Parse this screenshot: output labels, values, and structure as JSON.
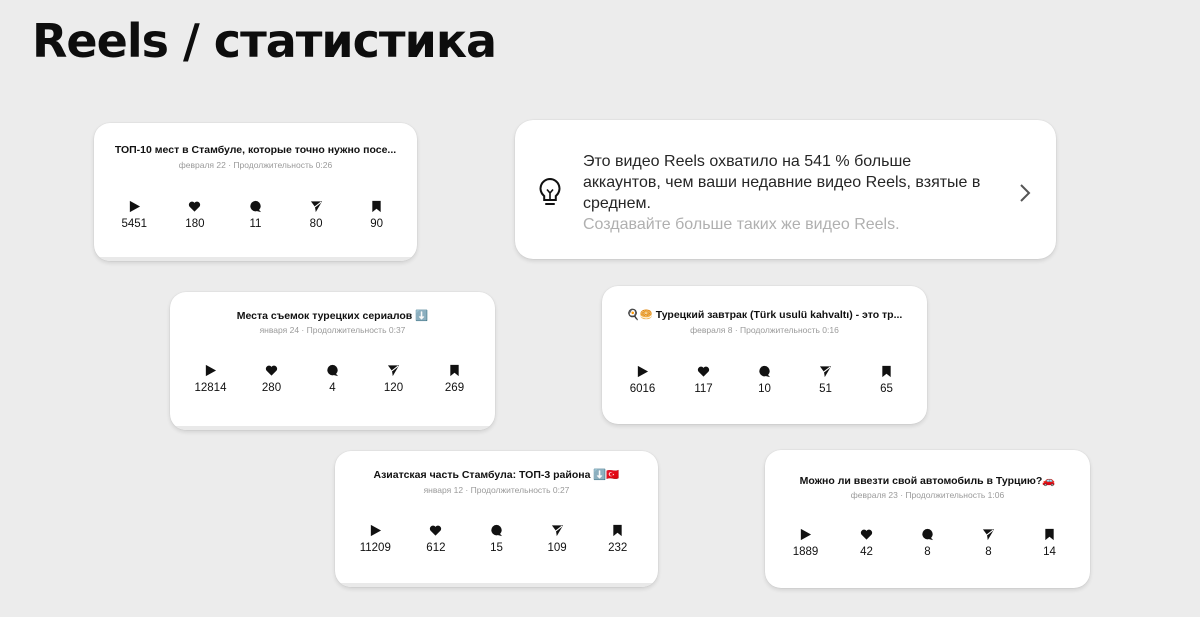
{
  "page": {
    "title": "Reels / статистика"
  },
  "insight": {
    "text": "Это видео Reels охватило на 541 % больше аккаунтов, чем ваши недавние видео Reels, взятые в среднем.",
    "subtext": "Создавайте больше таких же видео Reels.",
    "icon": "lightbulb-icon",
    "chevron_icon": "chevron-right-icon"
  },
  "colors": {
    "background": "#ececec",
    "card": "#ffffff",
    "meta": "#9a9a9a",
    "subtext": "#b0b0b0"
  },
  "stat_icons": [
    "play-icon",
    "heart-icon",
    "comment-icon",
    "share-icon",
    "bookmark-icon"
  ],
  "cards": [
    {
      "title": "ТОП-10 мест в Стамбуле, которые точно нужно посе...",
      "meta": "февраля 22 · Продолжительность 0:26",
      "stats": [
        "5451",
        "180",
        "11",
        "80",
        "90"
      ]
    },
    {
      "title": "Места съемок турецких сериалов ⬇️",
      "meta": "января 24 · Продолжительность 0:37",
      "stats": [
        "12814",
        "280",
        "4",
        "120",
        "269"
      ]
    },
    {
      "title": "🍳🥯 Турецкий завтрак (Türk usulü kahvaltı) - это тр...",
      "meta": "февраля 8 · Продолжительность 0:16",
      "stats": [
        "6016",
        "117",
        "10",
        "51",
        "65"
      ]
    },
    {
      "title": "Азиатская часть Стамбула: ТОП-3 района ⬇️🇹🇷",
      "meta": "января 12 · Продолжительность 0:27",
      "stats": [
        "11209",
        "612",
        "15",
        "109",
        "232"
      ]
    },
    {
      "title": "Можно ли ввезти свой автомобиль в Турцию?🚗",
      "meta": "февраля 23 · Продолжительность 1:06",
      "stats": [
        "1889",
        "42",
        "8",
        "8",
        "14"
      ]
    }
  ]
}
